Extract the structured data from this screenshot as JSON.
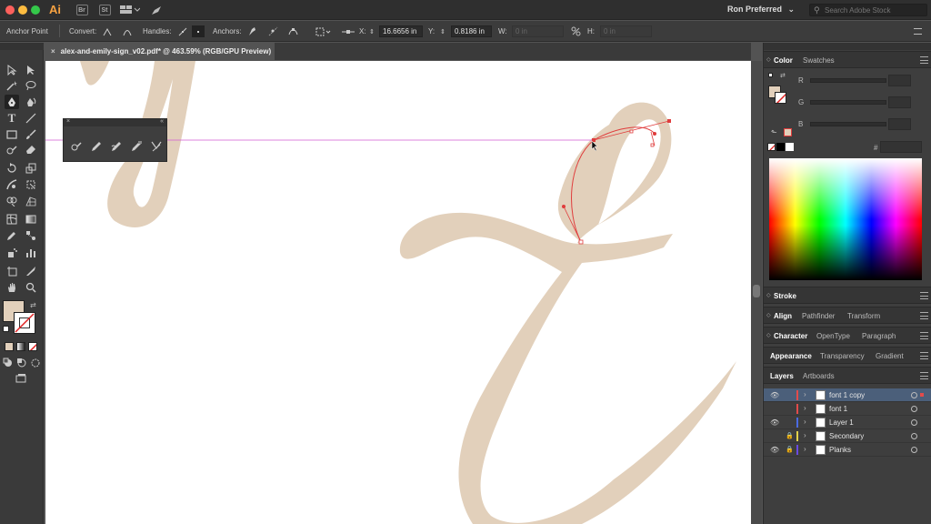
{
  "app": {
    "logo": "Ai"
  },
  "menubar": {
    "bridge_label": "Br",
    "stock_label": "St",
    "user_name": "Ron Preferred",
    "search_placeholder": "Search Adobe Stock"
  },
  "control_bar": {
    "tool_name": "Anchor Point",
    "convert_label": "Convert:",
    "handles_label": "Handles:",
    "anchors_label": "Anchors:",
    "x_label": "X:",
    "x_value": "16.6656 in",
    "y_label": "Y:",
    "y_value": "0.8186 in",
    "w_label": "W:",
    "w_value": "0 in",
    "h_label": "H:",
    "h_value": "0 in"
  },
  "document": {
    "tab_title": "alex-and-emily-sign_v02.pdf* @ 463.59% (RGB/GPU Preview)"
  },
  "colors": {
    "fill": "#e2d0bb",
    "path": "#e03c3c",
    "guide": "#d25ad2",
    "selection": "#4b5f7a"
  },
  "panels": {
    "color_tabs": [
      "Color",
      "Swatches"
    ],
    "color_channels": [
      "R",
      "G",
      "B"
    ],
    "hex_label": "#",
    "stroke_tab": "Stroke",
    "align_tabs": [
      "Align",
      "Pathfinder",
      "Transform"
    ],
    "character_tabs": [
      "Character",
      "OpenType",
      "Paragraph"
    ],
    "appearance_tabs": [
      "Appearance",
      "Transparency",
      "Gradient"
    ],
    "layers_tabs": [
      "Layers",
      "Artboards"
    ]
  },
  "layers": [
    {
      "name": "font 1 copy",
      "color": "#e24b4b",
      "visible": true,
      "locked": false,
      "selected": true
    },
    {
      "name": "font 1",
      "color": "#e24b4b",
      "visible": false,
      "locked": false,
      "selected": false
    },
    {
      "name": "Layer 1",
      "color": "#4b6be2",
      "visible": true,
      "locked": false,
      "selected": false
    },
    {
      "name": "Secondary",
      "color": "#e2d24b",
      "visible": false,
      "locked": true,
      "selected": false
    },
    {
      "name": "Planks",
      "color": "#6a4be2",
      "visible": true,
      "locked": true,
      "selected": false
    }
  ]
}
